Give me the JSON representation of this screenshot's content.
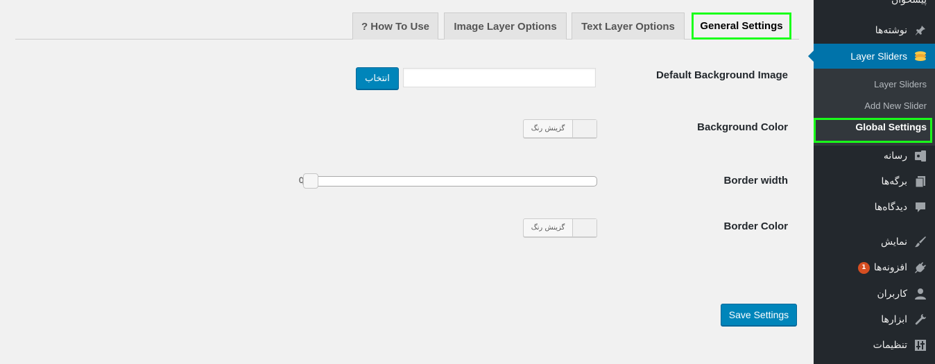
{
  "tabs": [
    {
      "label": "? How To Use"
    },
    {
      "label": "Image Layer Options"
    },
    {
      "label": "Text Layer Options"
    },
    {
      "label": "General Settings"
    }
  ],
  "form": {
    "default_bg_image_label": "Default Background Image",
    "default_bg_image_value": "",
    "select_button": "انتخاب",
    "bg_color_label": "Background Color",
    "bg_color_picker": "گزینش رنگ",
    "border_width_label": "Border width",
    "border_width_value": "0",
    "border_width_fraction": 0.0,
    "border_color_label": "Border Color",
    "border_color_picker": "گزینش رنگ",
    "save_button": "Save Settings"
  },
  "sidebar": {
    "top_fragment": "پیشخوان",
    "posts": "نوشته‌ها",
    "layer_sliders": "Layer Sliders",
    "submenu": [
      "Layer Sliders",
      "Add New Slider",
      "Global Settings"
    ],
    "media": "رسانه",
    "pages": "برگه‌ها",
    "comments": "دیدگاه‌ها",
    "appearance": "نمایش",
    "plugins": "افزونه‌ها",
    "plugins_badge": "1",
    "users": "کاربران",
    "tools": "ابزارها",
    "settings": "تنظیمات"
  },
  "colors": {
    "accent": "#0073aa",
    "button": "#0085ba",
    "highlight": "#1aff1a",
    "sidebar_bg": "#23282d"
  }
}
